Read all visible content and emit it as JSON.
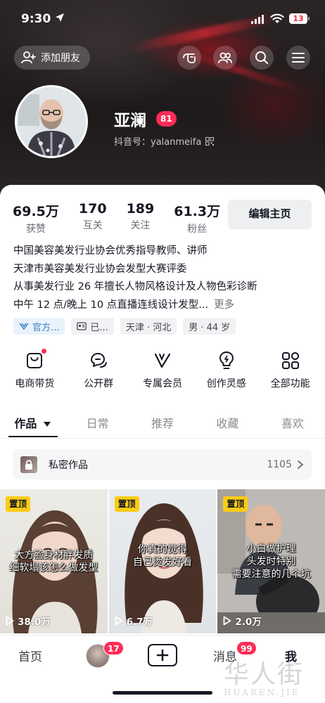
{
  "status_bar": {
    "time": "9:30",
    "battery": "13"
  },
  "header": {
    "add_friend_label": "添加朋友",
    "icons": [
      "shake-hand-icon",
      "friends-icon",
      "search-icon",
      "menu-icon"
    ]
  },
  "profile": {
    "name": "亚澜",
    "level": "81",
    "douyin_id": "抖音号：yalanmeifa",
    "stats": [
      {
        "value": "69.5万",
        "label": "获赞"
      },
      {
        "value": "170",
        "label": "互关"
      },
      {
        "value": "189",
        "label": "关注"
      },
      {
        "value": "61.3万",
        "label": "粉丝"
      }
    ],
    "edit_button": "编辑主页",
    "bio_lines": [
      "中国美容美发行业协会优秀指导教师、讲师",
      "天津市美容美发行业协会发型大赛评委",
      "从事美发行业 26 年擅长人物风格设计及人物色彩诊断",
      "中午 12 点/晚上 10 点直播连线设计发型..."
    ],
    "bio_more": "更多",
    "tags": [
      "官方...",
      "已...",
      "天津 · 河北",
      "男 · 44 岁"
    ]
  },
  "features": [
    {
      "label": "电商带货",
      "icon": "shopping-bag-icon",
      "dot": true
    },
    {
      "label": "公开群",
      "icon": "group-chat-icon",
      "dot": false
    },
    {
      "label": "专属会员",
      "icon": "vip-icon",
      "dot": false
    },
    {
      "label": "创作灵感",
      "icon": "lightbulb-icon",
      "dot": false
    },
    {
      "label": "全部功能",
      "icon": "grid-icon",
      "dot": false
    }
  ],
  "tabs": [
    "作品",
    "日常",
    "推荐",
    "收藏",
    "喜欢"
  ],
  "private_works": {
    "title": "私密作品",
    "count": "1105"
  },
  "videos": [
    {
      "pin": "置顶",
      "caption": [
        "大方脸身材胖发质",
        "细软塌该怎么做发型"
      ],
      "views": "38.0万"
    },
    {
      "pin": "置顶",
      "caption": [
        "你真的觉得",
        "自己烫发好看"
      ],
      "views": "6.7万"
    },
    {
      "pin": "置顶",
      "caption": [
        "小白做护理",
        "头发时特别",
        "需要注意的几个坑"
      ],
      "views": "2.0万"
    }
  ],
  "bottom_nav": {
    "home": "首页",
    "friends_badge": "17",
    "messages": "消息",
    "messages_badge": "99",
    "me": "我"
  },
  "watermark": {
    "chars": "华人街",
    "sub": "HUAREN.JIE"
  },
  "colors": {
    "accent_red": "#fe2c55",
    "pin_yellow": "#facc15",
    "tag_blue": "#3b82c4"
  }
}
